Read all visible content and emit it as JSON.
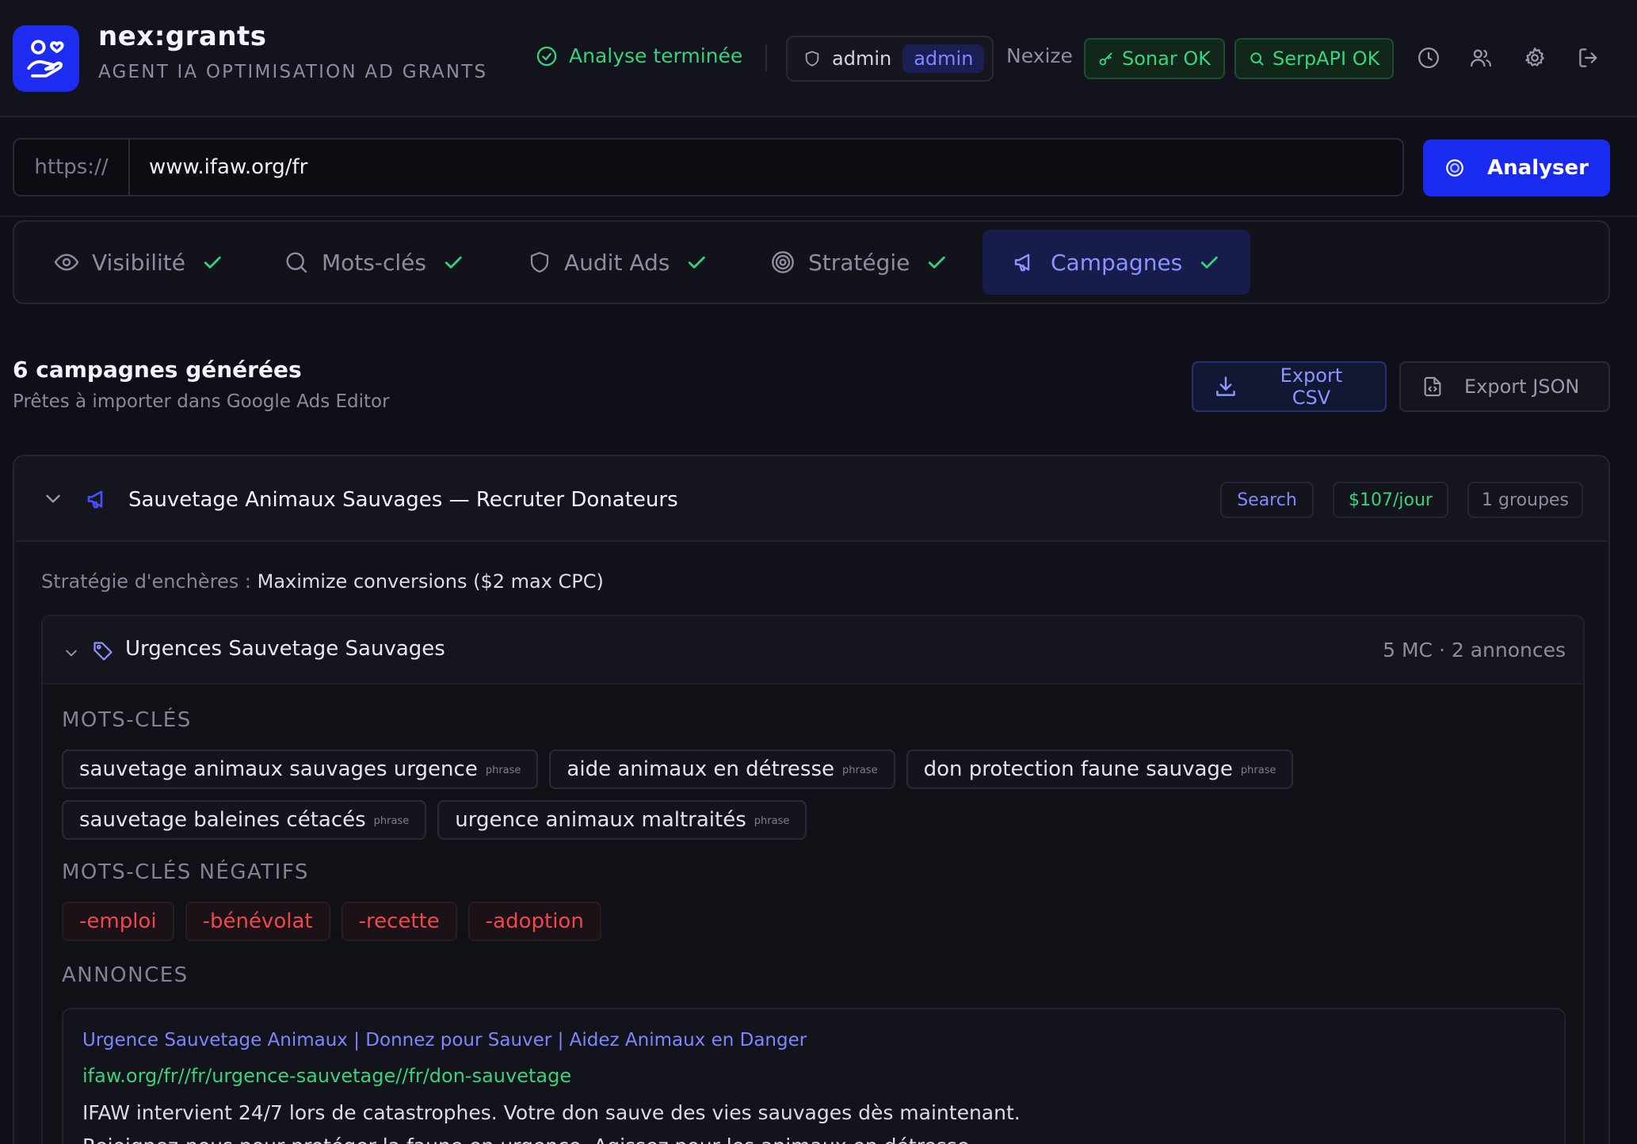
{
  "app": {
    "name": "nex:grants",
    "subtitle": "AGENT IA OPTIMISATION AD GRANTS"
  },
  "header": {
    "status": "Analyse terminée",
    "user": "admin",
    "role": "admin",
    "org": "Nexize",
    "badges": {
      "sonar": "Sonar OK",
      "serpapi": "SerpAPI OK"
    },
    "icons": [
      "clock-icon",
      "users-icon",
      "gear-icon",
      "logout-icon"
    ]
  },
  "url_bar": {
    "prefix": "https://",
    "value": "www.ifaw.org/fr",
    "button": "Analyser"
  },
  "tabs": [
    {
      "label": "Visibilité",
      "icon": "eye-icon",
      "done": true
    },
    {
      "label": "Mots-clés",
      "icon": "search-icon",
      "done": true
    },
    {
      "label": "Audit Ads",
      "icon": "shield-icon",
      "done": true
    },
    {
      "label": "Stratégie",
      "icon": "target-icon",
      "done": true
    },
    {
      "label": "Campagnes",
      "icon": "megaphone-icon",
      "done": true,
      "active": true
    }
  ],
  "summary": {
    "title": "6 campagnes générées",
    "subtitle": "Prêtes à importer dans Google Ads Editor",
    "export_csv": "Export CSV",
    "export_json": "Export JSON"
  },
  "campaign": {
    "name": "Sauvetage Animaux Sauvages — Recruter Donateurs",
    "type": "Search",
    "budget": "$107/jour",
    "groups": "1 groupes",
    "bid_label": "Stratégie d'enchères : ",
    "bid_value": "Maximize conversions ($2 max CPC)",
    "ad_group": {
      "name": "Urgences Sauvetage Sauvages",
      "meta": "5 MC · 2 annonces",
      "keywords_title": "MOTS-CLÉS",
      "keywords": [
        {
          "text": "sauvetage animaux sauvages urgence",
          "match": "phrase"
        },
        {
          "text": "aide animaux en détresse",
          "match": "phrase"
        },
        {
          "text": "don protection faune sauvage",
          "match": "phrase"
        },
        {
          "text": "sauvetage baleines cétacés",
          "match": "phrase"
        },
        {
          "text": "urgence animaux maltraités",
          "match": "phrase"
        }
      ],
      "negatives_title": "MOTS-CLÉS NÉGATIFS",
      "negatives": [
        "-emploi",
        "-bénévolat",
        "-recette",
        "-adoption"
      ],
      "ads_title": "ANNONCES",
      "ad": {
        "headline": "Urgence Sauvetage Animaux | Donnez pour Sauver | Aidez Animaux en Danger",
        "url": "ifaw.org/fr//fr/urgence-sauvetage//fr/don-sauvetage",
        "desc1": "IFAW intervient 24/7 lors de catastrophes. Votre don sauve des vies sauvages dès maintenant.",
        "desc2": "Rejoignez-nous pour protéger la faune en urgence. Agissez pour les animaux en détresse."
      }
    }
  },
  "colors": {
    "background": "#0f0f17",
    "accent": "#1a2bf0",
    "accent_text": "#8189ff",
    "success": "#37d27b",
    "danger": "#f0474f"
  }
}
